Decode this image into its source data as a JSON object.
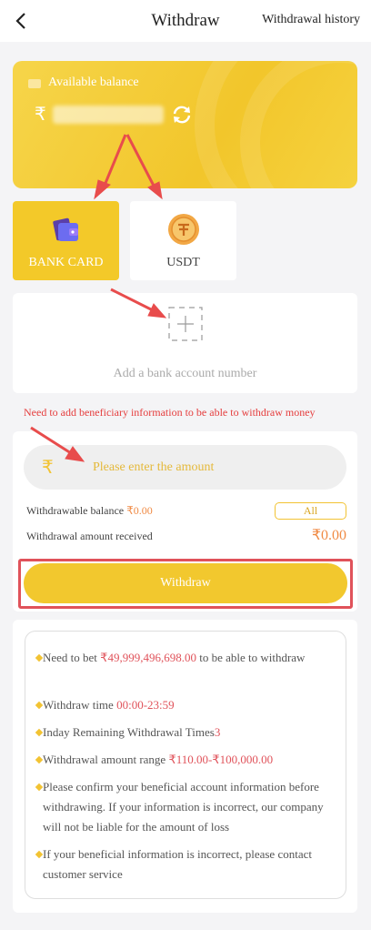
{
  "header": {
    "title": "Withdraw",
    "history_link": "Withdrawal history"
  },
  "balance_card": {
    "label": "Available balance",
    "currency": "₹"
  },
  "methods": [
    {
      "label": "BANK CARD",
      "selected": true,
      "icon": "bank-card-icon"
    },
    {
      "label": "USDT",
      "selected": false,
      "icon": "usdt-coin-icon"
    }
  ],
  "add_account": {
    "label": "Add a bank account number"
  },
  "notice": "Need to add beneficiary information to be able to withdraw money",
  "amount": {
    "currency": "₹",
    "placeholder": "Please enter the amount",
    "withdrawable_label": "Withdrawable balance ",
    "withdrawable_value": "₹0.00",
    "all_label": "All",
    "received_label": "Withdrawal amount received",
    "received_value": "₹0.00",
    "withdraw_label": "Withdraw"
  },
  "rules": [
    {
      "pre": "Need to bet ",
      "hl": "₹49,999,496,698.00",
      "post": " to be able to withdraw"
    },
    {
      "pre": "Withdraw time ",
      "hl": "00:00-23:59",
      "post": ""
    },
    {
      "pre": "Inday Remaining Withdrawal Times",
      "hl": "3",
      "post": ""
    },
    {
      "pre": "Withdrawal amount range ",
      "hl": "₹110.00-₹100,000.00",
      "post": ""
    },
    {
      "pre": "Please confirm your beneficial account information before withdrawing. If your information is incorrect, our company will not be liable for the amount of loss",
      "hl": "",
      "post": ""
    },
    {
      "pre": "If your beneficial information is incorrect, please contact customer service",
      "hl": "",
      "post": ""
    }
  ],
  "colors": {
    "accent": "#f2c82e",
    "highlight_red": "#e0525a",
    "orange_value": "#f08a44",
    "background": "#f4f4f6"
  }
}
